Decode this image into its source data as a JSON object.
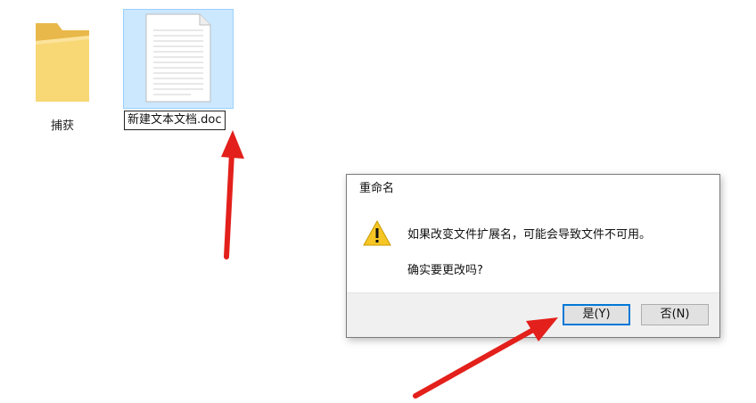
{
  "desktop": {
    "items": [
      {
        "label": "捕获",
        "icon": "folder-icon"
      },
      {
        "label": "新建文本文档.doc",
        "icon": "document-icon",
        "selected": true,
        "renaming": true
      }
    ]
  },
  "dialog": {
    "title": "重命名",
    "icon": "warning-icon",
    "message": "如果改变文件扩展名，可能会导致文件不可用。",
    "question": "确实要更改吗?",
    "yes_label": "是(Y)",
    "no_label": "否(N)"
  },
  "colors": {
    "selection_fill": "#cce8ff",
    "selection_border": "#99d1ff",
    "folder": "#f8d775",
    "default_button_border": "#0078d7",
    "annotation_arrow": "#e3201b"
  }
}
